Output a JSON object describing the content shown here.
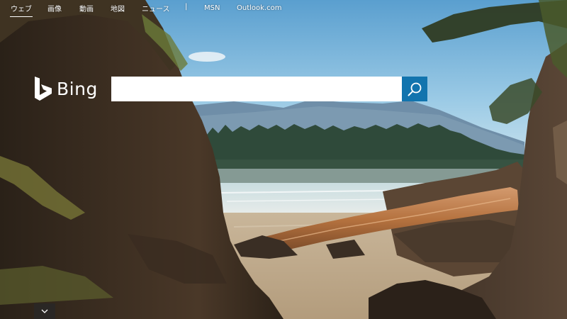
{
  "nav": {
    "items": [
      {
        "label": "ウェブ",
        "active": true
      },
      {
        "label": "画像"
      },
      {
        "label": "動画"
      },
      {
        "label": "地図"
      },
      {
        "label": "ニュース"
      }
    ],
    "separator": "|",
    "links": [
      {
        "label": "MSN"
      },
      {
        "label": "Outlook.com"
      }
    ]
  },
  "brand": {
    "name": "Bing",
    "logo_icon": "bing-logo-icon",
    "color": "#ffffff"
  },
  "search": {
    "value": "",
    "placeholder": "",
    "button_icon": "search-icon",
    "button_color": "#1274ae"
  },
  "scroll": {
    "icon": "chevron-down-icon"
  }
}
